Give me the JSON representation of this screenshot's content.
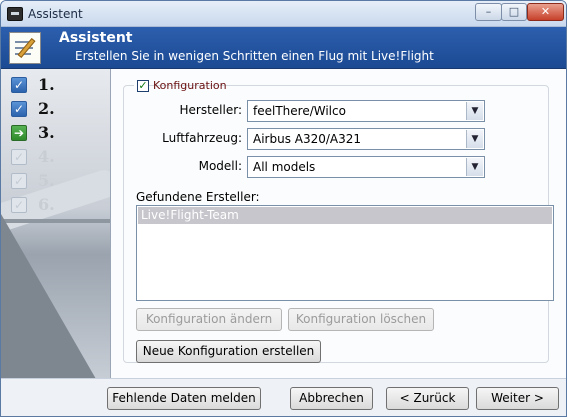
{
  "window": {
    "title": "Assistent",
    "controls": {
      "minimize": "–",
      "maximize": "□",
      "close": "✕"
    }
  },
  "header": {
    "title": "Assistent",
    "subtitle": "Erstellen Sie in wenigen Schritten einen Flug mit Live!Flight"
  },
  "steps": [
    {
      "label": "1.",
      "state": "done",
      "icon": "✓"
    },
    {
      "label": "2.",
      "state": "done",
      "icon": "✓"
    },
    {
      "label": "3.",
      "state": "current",
      "icon": "➔"
    },
    {
      "label": "4.",
      "state": "pending",
      "icon": "✓"
    },
    {
      "label": "5.",
      "state": "pending",
      "icon": "✓"
    },
    {
      "label": "6.",
      "state": "pending",
      "icon": "✓"
    }
  ],
  "config": {
    "checkbox_label": "Konfiguration",
    "checked": "✓",
    "hersteller_label": "Hersteller:",
    "hersteller_value": "feelThere/Wilco",
    "luftfahrzeug_label": "Luftfahrzeug:",
    "luftfahrzeug_value": "Airbus A320/A321",
    "modell_label": "Modell:",
    "modell_value": "All models",
    "dropdown_arrow": "▼",
    "found_label": "Gefundene Ersteller:",
    "found_items": [
      "Live!Flight-Team"
    ],
    "change_button": "Konfiguration ändern",
    "delete_button": "Konfiguration löschen",
    "new_button": "Neue Konfiguration erstellen"
  },
  "footer": {
    "report_button": "Fehlende Daten melden",
    "cancel_button": "Abbrechen",
    "back_button": "< Zurück",
    "next_button": "Weiter >"
  }
}
